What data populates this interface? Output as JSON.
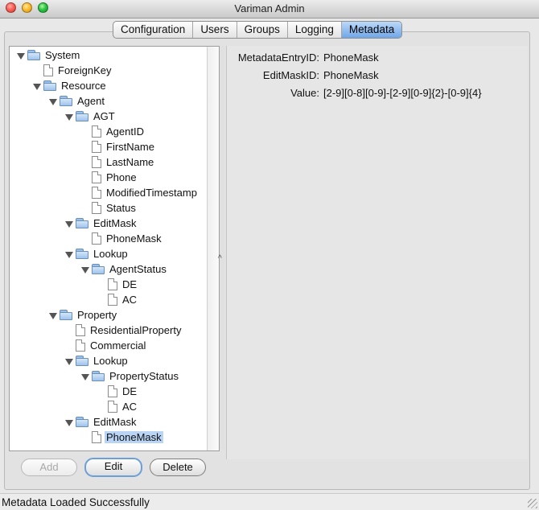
{
  "window": {
    "title": "Variman Admin"
  },
  "tabs": [
    "Configuration",
    "Users",
    "Groups",
    "Logging",
    "Metadata"
  ],
  "active_tab": "Metadata",
  "tree": {
    "nodes": [
      {
        "label": "System",
        "type": "folder",
        "expanded": true
      },
      {
        "label": "ForeignKey",
        "type": "doc"
      },
      {
        "label": "Resource",
        "type": "folder",
        "expanded": true
      },
      {
        "label": "Agent",
        "type": "folder",
        "expanded": true
      },
      {
        "label": "AGT",
        "type": "folder",
        "expanded": true
      },
      {
        "label": "AgentID",
        "type": "doc"
      },
      {
        "label": "FirstName",
        "type": "doc"
      },
      {
        "label": "LastName",
        "type": "doc"
      },
      {
        "label": "Phone",
        "type": "doc"
      },
      {
        "label": "ModifiedTimestamp",
        "type": "doc"
      },
      {
        "label": "Status",
        "type": "doc"
      },
      {
        "label": "EditMask",
        "type": "folder",
        "expanded": true
      },
      {
        "label": "PhoneMask",
        "type": "doc"
      },
      {
        "label": "Lookup",
        "type": "folder",
        "expanded": true
      },
      {
        "label": "AgentStatus",
        "type": "folder",
        "expanded": true
      },
      {
        "label": "DE",
        "type": "doc"
      },
      {
        "label": "AC",
        "type": "doc"
      },
      {
        "label": "Property",
        "type": "folder",
        "expanded": true
      },
      {
        "label": "ResidentialProperty",
        "type": "doc"
      },
      {
        "label": "Commercial",
        "type": "doc"
      },
      {
        "label": "Lookup",
        "type": "folder",
        "expanded": true
      },
      {
        "label": "PropertyStatus",
        "type": "folder",
        "expanded": true
      },
      {
        "label": "DE",
        "type": "doc"
      },
      {
        "label": "AC",
        "type": "doc"
      },
      {
        "label": "EditMask",
        "type": "folder",
        "expanded": true
      },
      {
        "label": "PhoneMask",
        "type": "doc",
        "selected": true
      }
    ]
  },
  "details": {
    "metadata_entry_id": {
      "key": "MetadataEntryID:",
      "value": "PhoneMask"
    },
    "edit_mask_id": {
      "key": "EditMaskID:",
      "value": "PhoneMask"
    },
    "value": {
      "key": "Value:",
      "value": "[2-9][0-8][0-9]-[2-9][0-9]{2}-[0-9]{4}"
    }
  },
  "buttons": {
    "add": "Add",
    "edit": "Edit",
    "delete": "Delete"
  },
  "splitter": {
    "arrow": "^"
  },
  "status": {
    "text": "Metadata Loaded Successfully"
  }
}
